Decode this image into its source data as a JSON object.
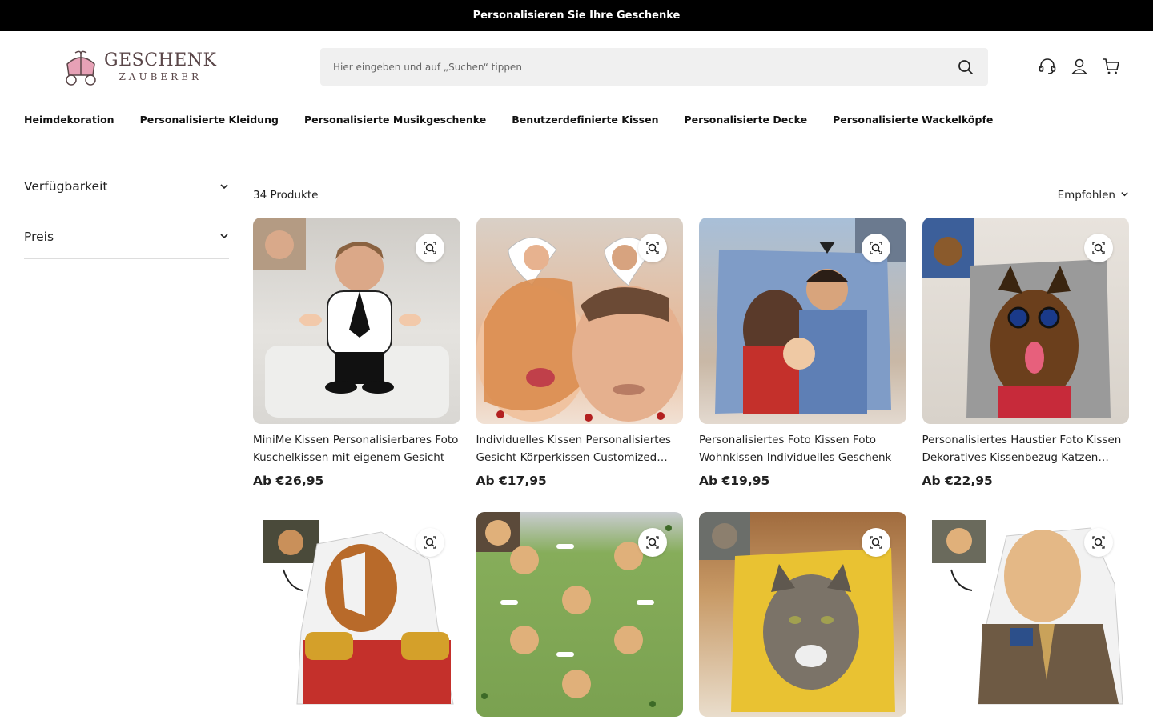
{
  "announcement": "Personalisieren Sie Ihre Geschenke",
  "logo": {
    "line1": "GESCHENK",
    "line2": "ZAUBERER"
  },
  "search": {
    "placeholder": "Hier eingeben und auf „Suchen“ tippen"
  },
  "nav": [
    "Heimdekoration",
    "Personalisierte Kleidung",
    "Personalisierte Musikgeschenke",
    "Benutzerdefinierte Kissen",
    "Personalisierte Decke",
    "Personalisierte Wackelköpfe"
  ],
  "filters": [
    "Verfügbarkeit",
    "Preis"
  ],
  "results": {
    "count": "34 Produkte",
    "sort": "Empfohlen"
  },
  "products": [
    {
      "title": "MiniMe Kissen Personalisierbares Foto Kuschelkissen mit eigenem Gesicht",
      "price": "Ab €26,95",
      "bg": "#d8d6d2"
    },
    {
      "title": "Individuelles Kissen Personalisiertes Gesicht Körperkissen Customized Kissen",
      "price": "Ab €17,95",
      "bg": "#e8c9b0"
    },
    {
      "title": "Personalisiertes Foto Kissen Foto Wohnkissen Individuelles Geschenk",
      "price": "Ab €19,95",
      "bg": "#8fa6c9"
    },
    {
      "title": "Personalisiertes Haustier Foto Kissen Dekoratives Kissenbezug Katzen Hunde",
      "price": "Ab €22,95",
      "bg": "#b9b7b4"
    },
    {
      "title": "",
      "price": "",
      "bg": "#ffffff"
    },
    {
      "title": "",
      "price": "",
      "bg": "#86ad5a"
    },
    {
      "title": "",
      "price": "",
      "bg": "#e9c232"
    },
    {
      "title": "",
      "price": "",
      "bg": "#ffffff"
    }
  ]
}
